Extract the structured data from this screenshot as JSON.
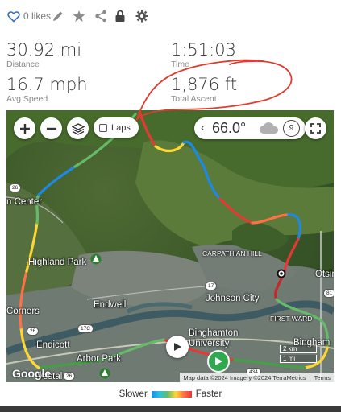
{
  "toolbar": {
    "likes_label": "0 likes",
    "icons": [
      "heart-icon",
      "pencil-icon",
      "star-icon",
      "share-icon",
      "lock-icon",
      "gear-icon"
    ],
    "icon_color": "#8a8a8a",
    "heart_color": "#3b6fc2"
  },
  "stats": {
    "distance": {
      "value": "30.92 mi",
      "label": "Distance"
    },
    "time": {
      "value": "1:51:03",
      "label": "Time"
    },
    "speed": {
      "value": "16.7 mph",
      "label": "Avg Speed"
    },
    "ascent": {
      "value": "1,876 ft",
      "label": "Total Ascent"
    }
  },
  "map": {
    "laps_label": "Laps",
    "weather_temp": "66.0°",
    "wind_speed": "9",
    "labels": {
      "highland_park": "Highland Park",
      "endwell": "Endwell",
      "johnson_city": "Johnson City",
      "endicott": "Endicott",
      "binghamton_university": "Binghamton University",
      "carpathian_hill": "CARPATHIAN HILL",
      "first_ward": "FIRST WARD",
      "n_center": "n Center",
      "corners": "Corners",
      "arbor_park": "Arbor Park",
      "vestal": "Vestal",
      "otsin": "Otsin",
      "binghamton_partial": "Bingham"
    },
    "route_shields": [
      "26",
      "17",
      "17C",
      "26",
      "26",
      "434",
      "81"
    ],
    "scale": {
      "km": "2 km",
      "mi": "1 mi"
    },
    "google_logo": "Google",
    "attribution": "Map data ©2024 Imagery ©2024 TerraMetrics",
    "terms": "Terms"
  },
  "legend": {
    "slower": "Slower",
    "faster": "Faster",
    "gradient_colors": [
      "#1e88e5",
      "#66bb6a",
      "#fdd835",
      "#e53935"
    ]
  },
  "annotation_color": "#e23b2e"
}
